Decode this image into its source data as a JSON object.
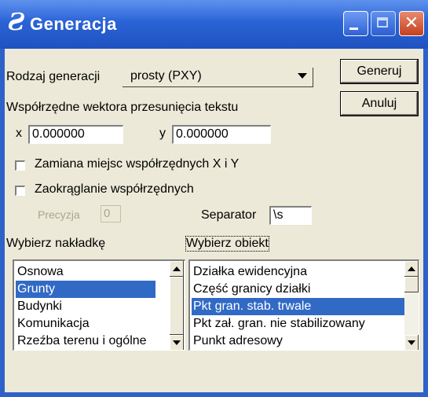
{
  "window": {
    "title": "Generacja"
  },
  "generation_type": {
    "label": "Rodzaj generacji",
    "value": "prosty (PXY)"
  },
  "buttons": {
    "generate": "Generuj",
    "cancel": "Anuluj"
  },
  "shift_vector": {
    "label": "Współrzędne wektora przesunięcia tekstu",
    "x_label": "x",
    "x_value": "0.000000",
    "y_label": "y",
    "y_value": "0.000000"
  },
  "options": {
    "swap_label": "Zamiana miejsc współrzędnych X i Y",
    "round_label": "Zaokrąglanie współrzędnych"
  },
  "precision": {
    "label": "Precyzja",
    "value": "0"
  },
  "separator": {
    "label": "Separator",
    "value": "\\s"
  },
  "overlay": {
    "label": "Wybierz nakładkę",
    "items": [
      "Osnowa",
      "Grunty",
      "Budynki",
      "Komunikacja",
      "Rzeźba terenu i ogólne"
    ],
    "selected_index": 1
  },
  "object": {
    "label": "Wybierz obiekt",
    "items": [
      "Działka ewidencyjna",
      "Część granicy działki",
      "Pkt gran. stab. trwale",
      "Pkt zał. gran. nie stabilizowany",
      "Punkt adresowy"
    ],
    "selected_index": 2
  },
  "icons": {
    "title": "app-icon",
    "minimize": "minimize-icon",
    "maximize": "maximize-icon",
    "close": "close-icon"
  },
  "colors": {
    "titlebar": "#2a63d6",
    "selection": "#316ac5",
    "close": "#c5401d"
  }
}
